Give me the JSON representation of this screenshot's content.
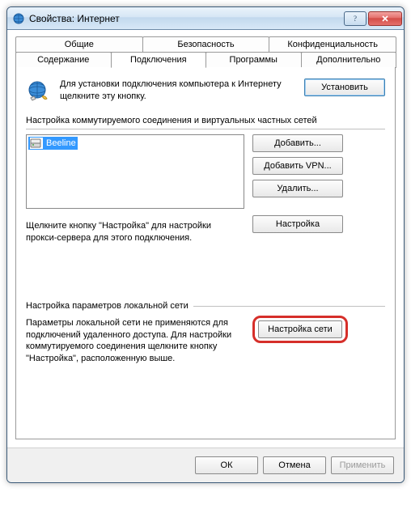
{
  "window": {
    "title": "Свойства: Интернет"
  },
  "tabs": {
    "row1": [
      "Общие",
      "Безопасность",
      "Конфиденциальность"
    ],
    "row2": [
      "Содержание",
      "Подключения",
      "Программы",
      "Дополнительно"
    ],
    "active": "Подключения"
  },
  "setup": {
    "text": "Для установки подключения компьютера к Интернету щелкните эту кнопку.",
    "button": "Установить"
  },
  "dialup": {
    "group_label": "Настройка коммутируемого соединения и виртуальных частных сетей",
    "items": [
      "Beeline"
    ],
    "add": "Добавить...",
    "add_vpn": "Добавить VPN...",
    "remove": "Удалить...",
    "hint": "Щелкните кнопку \"Настройка\" для настройки прокси-сервера для этого подключения.",
    "settings": "Настройка"
  },
  "lan": {
    "group_label": "Настройка параметров локальной сети",
    "hint": "Параметры локальной сети не применяются для подключений удаленного доступа. Для настройки коммутируемого соединения щелкните кнопку \"Настройка\", расположенную выше.",
    "button": "Настройка сети"
  },
  "footer": {
    "ok": "ОК",
    "cancel": "Отмена",
    "apply": "Применить"
  }
}
